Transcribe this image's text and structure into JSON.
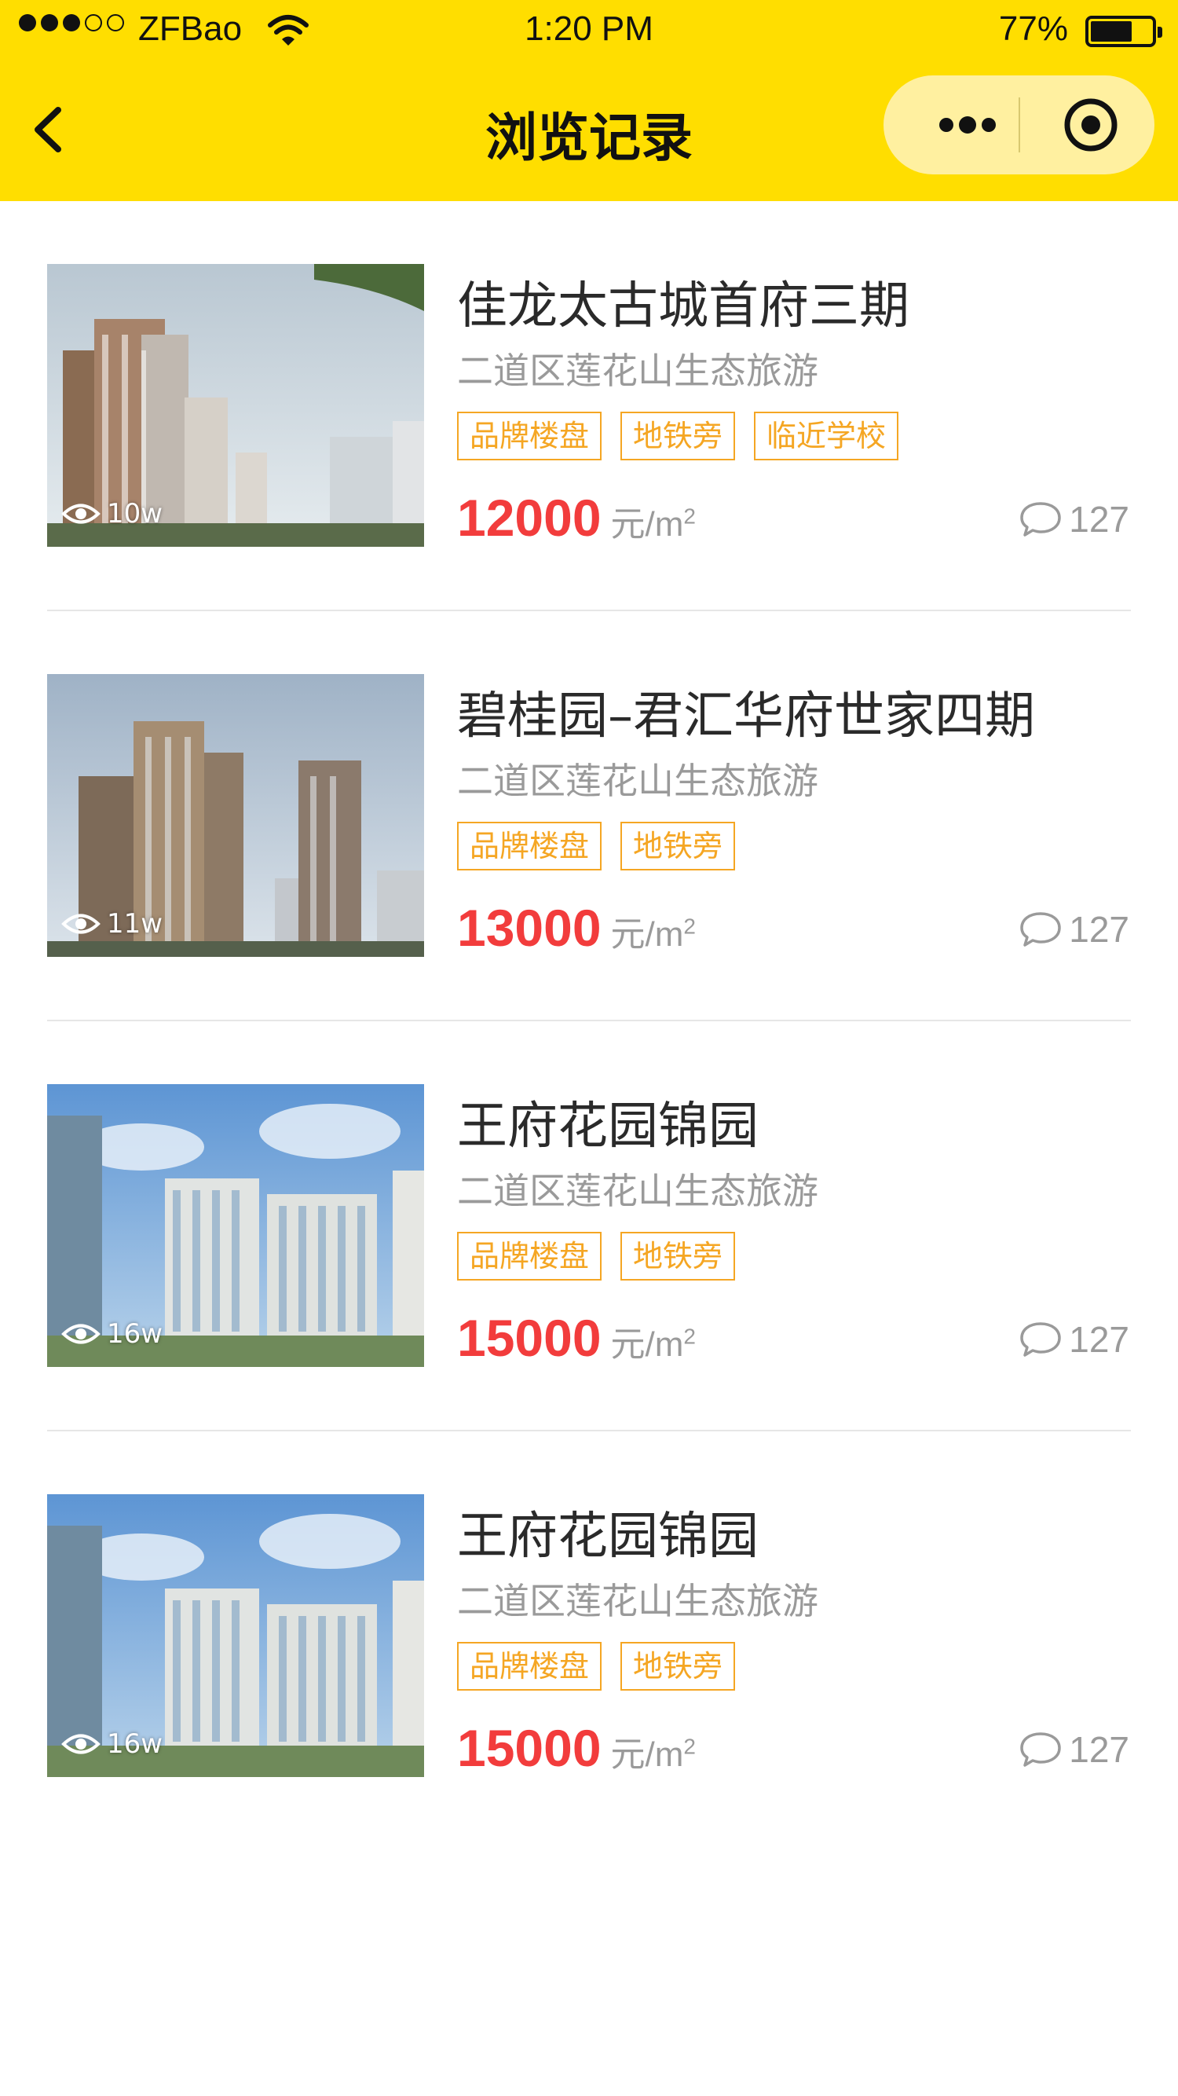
{
  "status_bar": {
    "carrier": "ZFBao",
    "time": "1:20 PM",
    "battery": "77%",
    "battery_level": 0.77,
    "signal_bars": 3
  },
  "nav": {
    "title": "浏览记录",
    "back_icon": "chevron-left-icon",
    "more_icon": "more-dots-icon",
    "target_icon": "target-circle-icon"
  },
  "items": [
    {
      "title": "佳龙太古城首府三期",
      "address": "二道区莲花山生态旅游",
      "tags": [
        "品牌楼盘",
        "地铁旁",
        "临近学校"
      ],
      "price": "12000",
      "unit": "元/m",
      "unit_sup": "2",
      "views": "10w",
      "comments": "127"
    },
    {
      "title": "碧桂园–君汇华府世家四期",
      "address": "二道区莲花山生态旅游",
      "tags": [
        "品牌楼盘",
        "地铁旁"
      ],
      "price": "13000",
      "unit": "元/m",
      "unit_sup": "2",
      "views": "11w",
      "comments": "127"
    },
    {
      "title": "王府花园锦园",
      "address": "二道区莲花山生态旅游",
      "tags": [
        "品牌楼盘",
        "地铁旁"
      ],
      "price": "15000",
      "unit": "元/m",
      "unit_sup": "2",
      "views": "16w",
      "comments": "127"
    },
    {
      "title": "王府花园锦园",
      "address": "二道区莲花山生态旅游",
      "tags": [
        "品牌楼盘",
        "地铁旁"
      ],
      "price": "15000",
      "unit": "元/m",
      "unit_sup": "2",
      "views": "16w",
      "comments": "127"
    }
  ],
  "colors": {
    "header": "#ffde00",
    "price": "#f23c3c",
    "tag": "#f5a623",
    "secondary_text": "#9a9a9a"
  }
}
